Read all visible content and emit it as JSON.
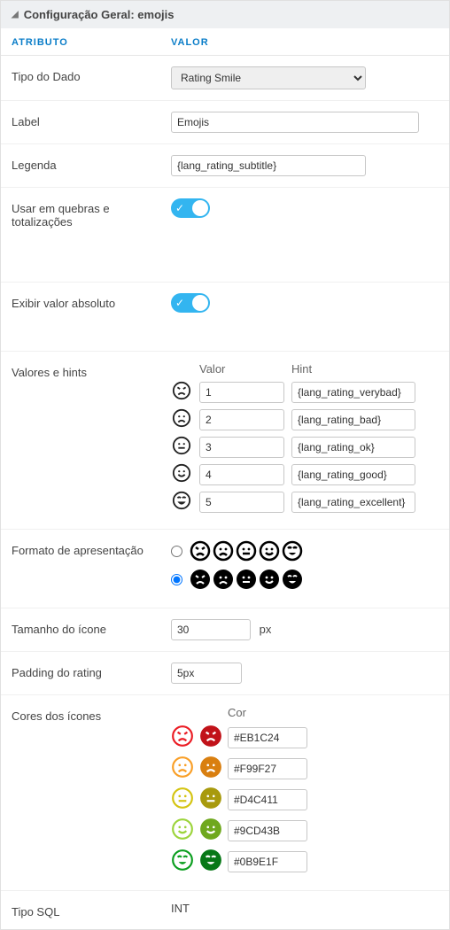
{
  "panel": {
    "title": "Configuração Geral: emojis"
  },
  "columns": {
    "attribute": "ATRIBUTO",
    "value": "VALOR"
  },
  "fields": {
    "tipoDado": {
      "label": "Tipo do Dado",
      "value": "Rating Smile"
    },
    "label": {
      "label": "Label",
      "value": "Emojis"
    },
    "legenda": {
      "label": "Legenda",
      "value": "{lang_rating_subtitle}"
    },
    "usarQuebras": {
      "label": "Usar em quebras e totalizações"
    },
    "exibirAbs": {
      "label": "Exibir valor absoluto"
    },
    "valoresHints": {
      "label": "Valores e hints",
      "headerValor": "Valor",
      "headerHint": "Hint",
      "rows": [
        {
          "valor": "1",
          "hint": "{lang_rating_verybad}"
        },
        {
          "valor": "2",
          "hint": "{lang_rating_bad}"
        },
        {
          "valor": "3",
          "hint": "{lang_rating_ok}"
        },
        {
          "valor": "4",
          "hint": "{lang_rating_good}"
        },
        {
          "valor": "5",
          "hint": "{lang_rating_excellent}"
        }
      ]
    },
    "formato": {
      "label": "Formato de apresentação"
    },
    "tamanho": {
      "label": "Tamanho do ícone",
      "value": "30",
      "unit": "px"
    },
    "padding": {
      "label": "Padding do rating",
      "value": "5px"
    },
    "cores": {
      "label": "Cores dos ícones",
      "header": "Cor",
      "rows": [
        {
          "hex": "#EB1C24",
          "outline": "#EB1C24",
          "fill": "#c11219"
        },
        {
          "hex": "#F99F27",
          "outline": "#F99F27",
          "fill": "#d97f10"
        },
        {
          "hex": "#D4C411",
          "outline": "#D4C411",
          "fill": "#a89a0d"
        },
        {
          "hex": "#9CD43B",
          "outline": "#9CD43B",
          "fill": "#6fa81e"
        },
        {
          "hex": "#0B9E1F",
          "outline": "#0B9E1F",
          "fill": "#087817"
        }
      ]
    },
    "tipoSql": {
      "label": "Tipo SQL",
      "value": "INT"
    }
  }
}
